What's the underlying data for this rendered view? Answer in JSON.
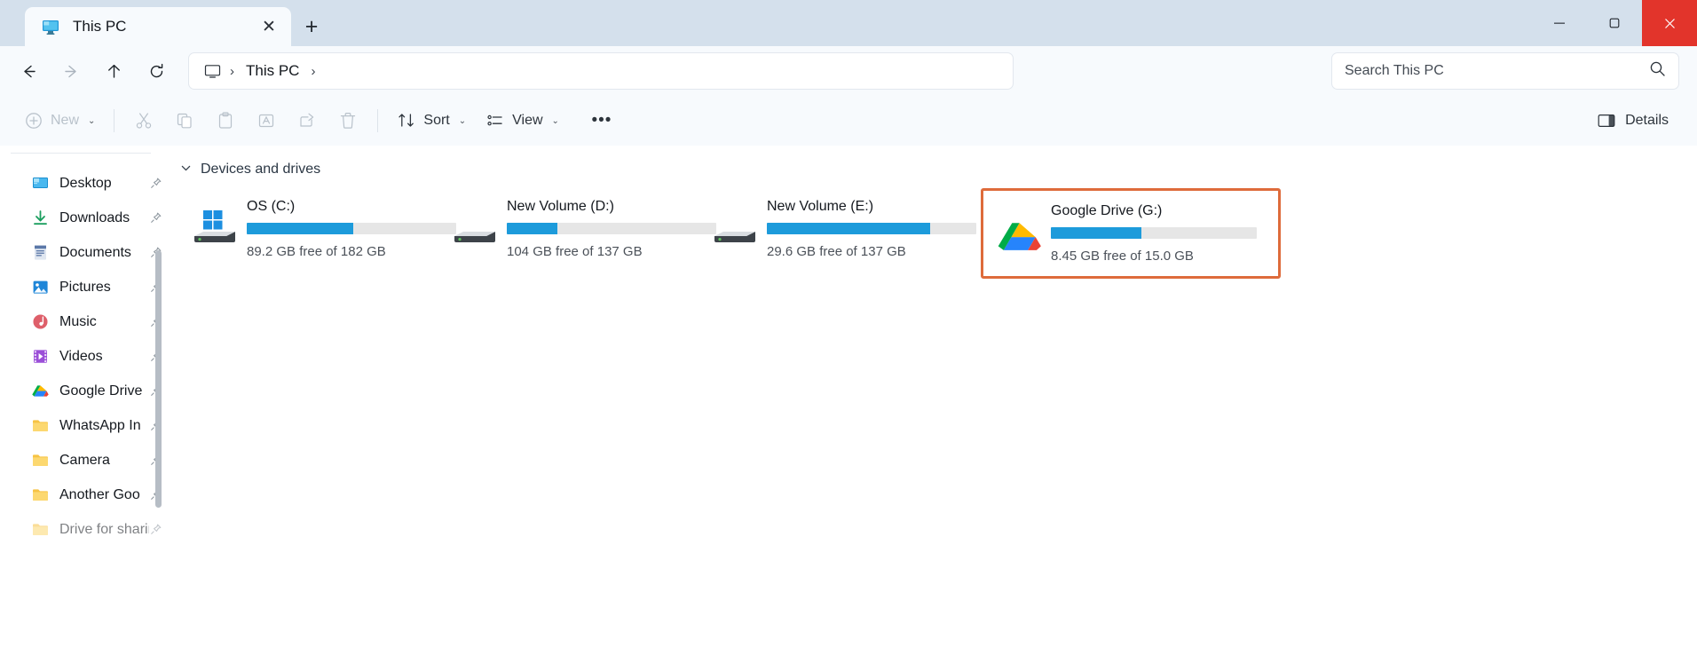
{
  "window": {
    "tab": {
      "title": "This PC",
      "icon": "monitor-icon",
      "close_label": "✕"
    },
    "new_tab_label": "+",
    "controls": {
      "minimize": "─",
      "maximize": "❐",
      "close": "✕"
    }
  },
  "address": {
    "back": "←",
    "forward": "→",
    "up": "↑",
    "refresh": "⟳",
    "crumb_icon": "this-pc-icon",
    "sep1": "›",
    "crumb": "This PC",
    "sep2": "›"
  },
  "search": {
    "placeholder": "Search This PC",
    "icon": "search-icon"
  },
  "toolbar": {
    "new_label": "New",
    "new_chevron": "⌄",
    "cut": "cut-icon",
    "copy": "copy-icon",
    "paste": "paste-icon",
    "rename": "rename-icon",
    "share": "share-icon",
    "delete": "delete-icon",
    "sort_label": "Sort",
    "sort_chevron": "⌄",
    "view_label": "View",
    "view_chevron": "⌄",
    "more_label": "•••",
    "details_label": "Details"
  },
  "sidebar": {
    "items": [
      {
        "label": "Desktop",
        "icon": "desktop-icon",
        "pinned": true
      },
      {
        "label": "Downloads",
        "icon": "downloads-icon",
        "pinned": true
      },
      {
        "label": "Documents",
        "icon": "documents-icon",
        "pinned": true
      },
      {
        "label": "Pictures",
        "icon": "pictures-icon",
        "pinned": true
      },
      {
        "label": "Music",
        "icon": "music-icon",
        "pinned": true
      },
      {
        "label": "Videos",
        "icon": "videos-icon",
        "pinned": true
      },
      {
        "label": "Google Drive",
        "icon": "google-drive-icon",
        "pinned": true
      },
      {
        "label": "WhatsApp In",
        "icon": "folder-icon",
        "pinned": true
      },
      {
        "label": "Camera",
        "icon": "folder-icon",
        "pinned": true
      },
      {
        "label": "Another Goo",
        "icon": "folder-icon",
        "pinned": true
      },
      {
        "label": "Drive for sharing",
        "icon": "folder-icon",
        "pinned": true
      }
    ],
    "pin_glyph": "📌"
  },
  "main": {
    "group": {
      "title": "Devices and drives",
      "chevron": "⌄"
    },
    "drives": [
      {
        "name": "OS (C:)",
        "icon": "windows-drive-icon",
        "usage_percent": 51,
        "free_text": "89.2 GB free of 182 GB",
        "highlighted": false
      },
      {
        "name": "New Volume (D:)",
        "icon": "hdd-icon",
        "usage_percent": 24,
        "free_text": "104 GB free of 137 GB",
        "highlighted": false
      },
      {
        "name": "New Volume (E:)",
        "icon": "hdd-icon",
        "usage_percent": 78,
        "free_text": "29.6 GB free of 137 GB",
        "highlighted": false
      },
      {
        "name": "Google Drive (G:)",
        "icon": "google-drive-icon",
        "usage_percent": 44,
        "free_text": "8.45 GB free of 15.0 GB",
        "highlighted": true
      }
    ]
  },
  "colors": {
    "accent_bar": "#1d9bdb",
    "highlight_border": "#de6b3b",
    "titlebar": "#d4e0ec",
    "close_button": "#e2342b"
  }
}
